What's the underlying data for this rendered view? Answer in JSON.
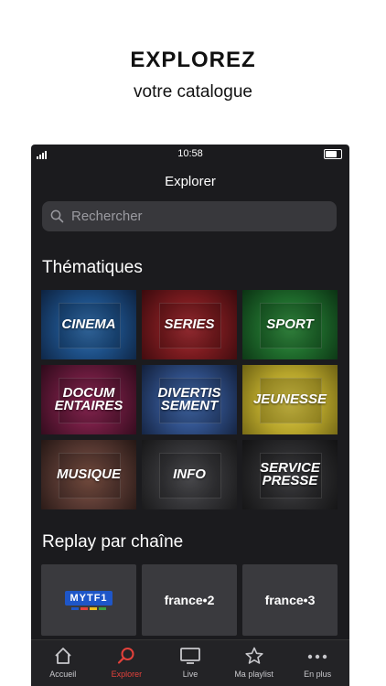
{
  "promo": {
    "title": "EXPLOREZ",
    "subtitle": "votre catalogue"
  },
  "status_bar": {
    "time": "10:58"
  },
  "header": {
    "title": "Explorer"
  },
  "search": {
    "placeholder": "Rechercher"
  },
  "thematiques": {
    "title": "Thématiques",
    "items": [
      {
        "label": "CINEMA",
        "color": "#1d4f86"
      },
      {
        "label": "SERIES",
        "color": "#7a1b1f"
      },
      {
        "label": "SPORT",
        "color": "#1f6b2c"
      },
      {
        "label": "DOCUM\nENTAIRES",
        "color": "#6b1b3e"
      },
      {
        "label": "DIVERTIS\nSEMENT",
        "color": "#2f4e86"
      },
      {
        "label": "JEUNESSE",
        "color": "#b5a32a"
      },
      {
        "label": "MUSIQUE",
        "color": "#5a3a33"
      },
      {
        "label": "INFO",
        "color": "#353538"
      },
      {
        "label": "SERVICE\nPRESSE",
        "color": "#2c2c2e"
      }
    ]
  },
  "replay": {
    "title": "Replay par chaîne",
    "channels": [
      {
        "label": "MYTF1"
      },
      {
        "label": "france•2"
      },
      {
        "label": "france•3"
      }
    ]
  },
  "tabbar": {
    "items": [
      {
        "label": "Accueil",
        "icon": "home-icon"
      },
      {
        "label": "Explorer",
        "icon": "search-icon"
      },
      {
        "label": "Live",
        "icon": "tv-icon"
      },
      {
        "label": "Ma playlist",
        "icon": "star-icon"
      },
      {
        "label": "En plus",
        "icon": "more-icon"
      }
    ],
    "active_color": "#e4413b"
  }
}
